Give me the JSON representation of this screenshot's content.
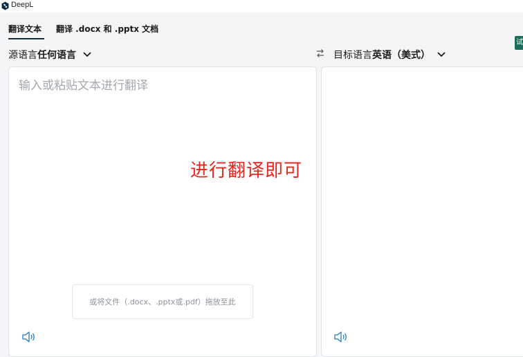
{
  "window": {
    "title": "DeepL"
  },
  "tabs": [
    {
      "label": "翻译文本",
      "active": true
    },
    {
      "label": "翻译 .docx 和 .pptx 文档",
      "active": false
    }
  ],
  "corner_button": {
    "label": "试"
  },
  "source_lang": {
    "prefix": "源语言",
    "value": "任何语言"
  },
  "target_lang": {
    "prefix": "目标语言",
    "value": "英语（美式）"
  },
  "source": {
    "placeholder": "输入或粘贴文本进行翻译"
  },
  "annotation": {
    "text": "进行翻译即可",
    "color": "#e8261c"
  },
  "dropzone": {
    "label": "或将文件（.docx、.pptx或.pdf）拖放至此"
  },
  "colors": {
    "accent": "#0f2b46",
    "icon_blue": "#2a7ab8",
    "brand_green": "#1c6c5a"
  }
}
